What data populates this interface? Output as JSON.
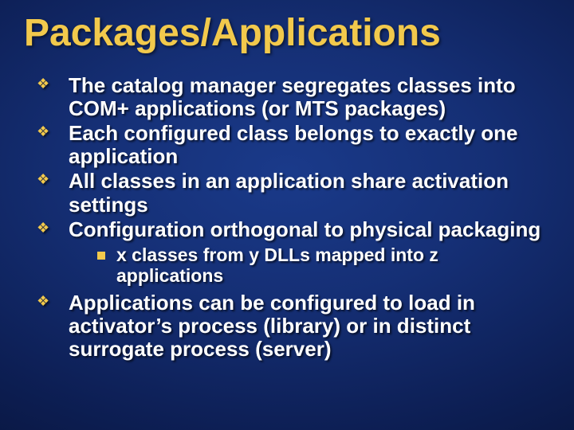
{
  "title": "Packages/Applications",
  "bullets": [
    {
      "text": "The catalog manager segregates classes into COM+ applications (or MTS packages)"
    },
    {
      "text": "Each configured class belongs to exactly one application"
    },
    {
      "text": "All classes in an application share activation settings"
    },
    {
      "text": "Configuration orthogonal to physical packaging",
      "sub": [
        {
          "text": "x classes from y DLLs mapped into z applications"
        }
      ]
    },
    {
      "text": "Applications can be configured to load in activator’s process (library) or in distinct surrogate process (server)"
    }
  ]
}
